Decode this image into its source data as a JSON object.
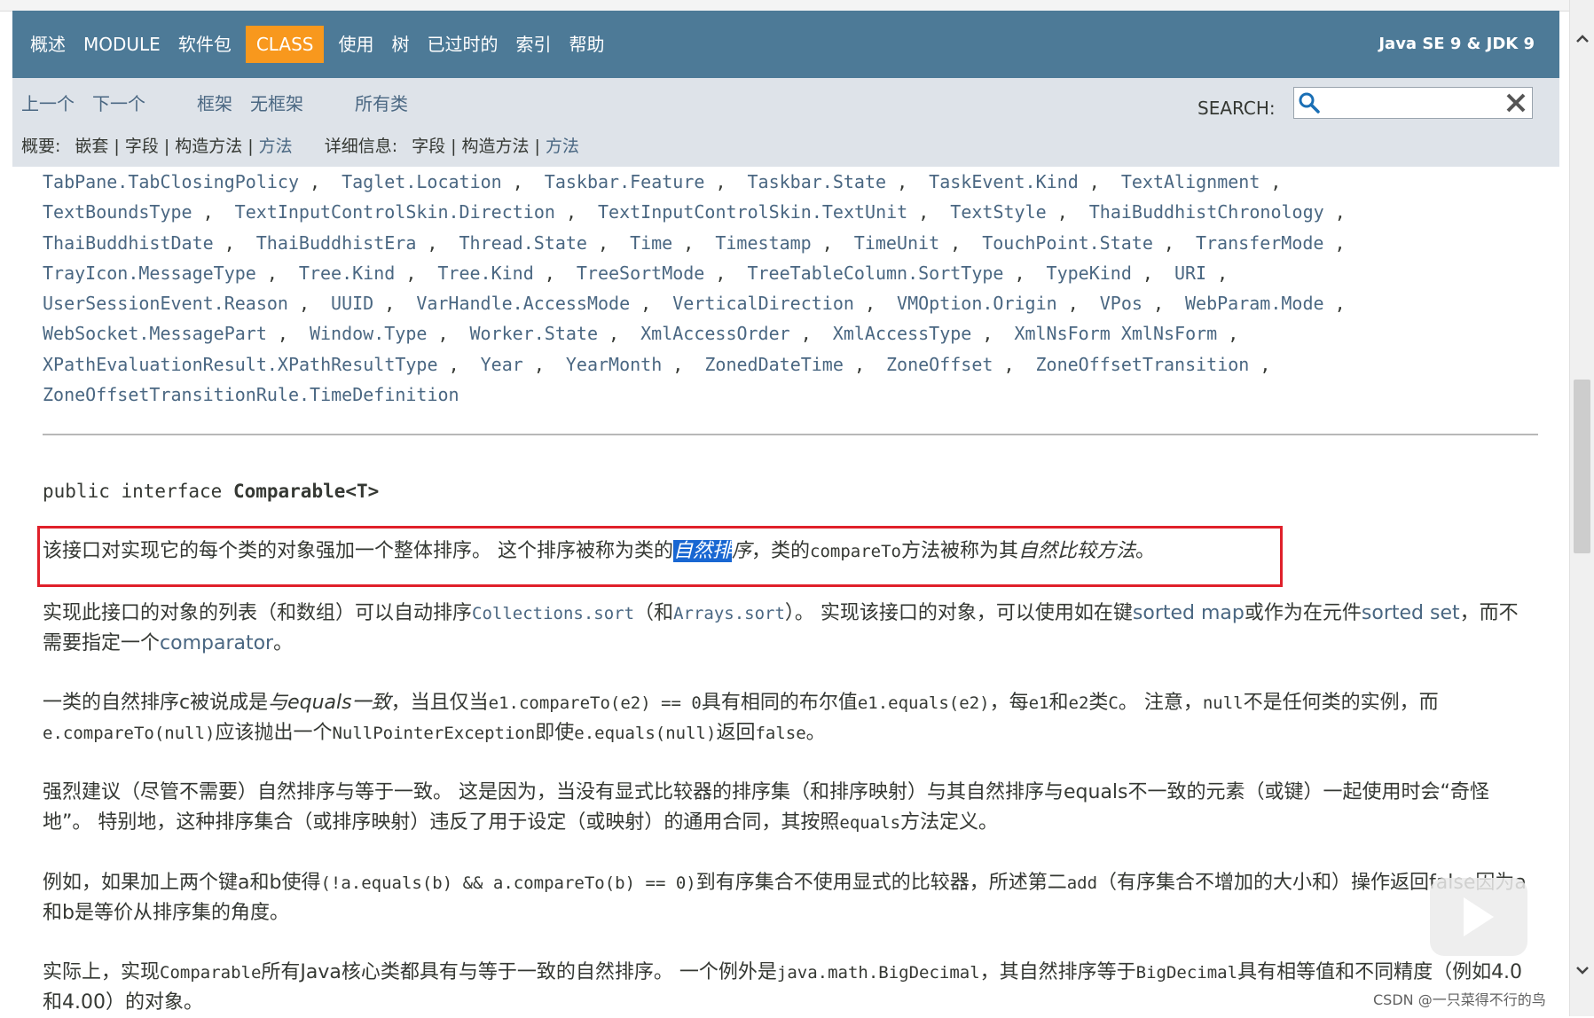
{
  "navbar": {
    "items": [
      "概述",
      "MODULE",
      "软件包",
      "CLASS",
      "使用",
      "树",
      "已过时的",
      "索引",
      "帮助"
    ],
    "active_index": 3,
    "brand": "Java SE 9 & JDK 9"
  },
  "subnav": {
    "prev": "上一个",
    "next": "下一个",
    "frames": "框架",
    "no_frames": "无框架",
    "all_classes": "所有类",
    "summary_label": "概要:",
    "summary_links": [
      {
        "text": "嵌套",
        "link": false
      },
      {
        "text": "字段",
        "link": false
      },
      {
        "text": "构造方法",
        "link": false
      },
      {
        "text": "方法",
        "link": true
      }
    ],
    "detail_label": "详细信息:",
    "detail_links": [
      {
        "text": "字段",
        "link": false
      },
      {
        "text": "构造方法",
        "link": false
      },
      {
        "text": "方法",
        "link": true
      }
    ],
    "search_label": "SEARCH:",
    "search_value": ""
  },
  "enum_lines": [
    [
      "TabPane.TabClosingPolicy",
      "Taglet.Location",
      "Taskbar.Feature",
      "Taskbar.State",
      "TaskEvent.Kind",
      "TextAlignment"
    ],
    [
      "TextBoundsType",
      "TextInputControlSkin.Direction",
      "TextInputControlSkin.TextUnit",
      "TextStyle",
      "ThaiBuddhistChronology"
    ],
    [
      "ThaiBuddhistDate",
      "ThaiBuddhistEra",
      "Thread.State",
      "Time",
      "Timestamp",
      "TimeUnit",
      "TouchPoint.State",
      "TransferMode"
    ],
    [
      "TrayIcon.MessageType",
      "Tree.Kind",
      "Tree.Kind",
      "TreeSortMode",
      "TreeTableColumn.SortType",
      "TypeKind",
      "URI"
    ],
    [
      "UserSessionEvent.Reason",
      "UUID",
      "VarHandle.AccessMode",
      "VerticalDirection",
      "VMOption.Origin",
      "VPos",
      "WebParam.Mode"
    ],
    [
      "WebSocket.MessagePart",
      "Window.Type",
      "Worker.State",
      "XmlAccessOrder",
      "XmlAccessType",
      "XmlNsForm XmlNsForm"
    ],
    [
      "XPathEvaluationResult.XPathResultType",
      "Year",
      "YearMonth",
      "ZonedDateTime",
      "ZoneOffset",
      "ZoneOffsetTransition"
    ],
    [
      "ZoneOffsetTransitionRule.TimeDefinition"
    ]
  ],
  "signature": {
    "prefix": "public interface ",
    "name": "Comparable<T>"
  },
  "para1": {
    "t1": "该接口对实现它的每个类的对象强加一个整体排序。 这个排序被称为类的",
    "hl": "自然排",
    "t2": "序",
    "t3": "，类的",
    "code": "compareTo",
    "t4": "方法被称为其",
    "t5": "自然比较方法",
    "t6": "。"
  },
  "para2": {
    "t1": "实现此接口的对象的列表（和数组）可以自动排序",
    "c1": "Collections.sort",
    "t2": "（和",
    "c2": "Arrays.sort",
    "t3": "）。 实现该接口的对象，可以使用如在键",
    "l1": "sorted map",
    "t4": "或作为在元件",
    "l2": "sorted set",
    "t5": "，而不需要指定一个",
    "l3": "comparator",
    "t6": "。"
  },
  "para3": {
    "t1": "一类的自然排序c被说成是",
    "i1": "与equals一致",
    "t2": "，当且仅当",
    "c1": "e1.compareTo(e2) == 0",
    "t3": "具有相同的布尔值",
    "c2": "e1.equals(e2)",
    "t4": "，每",
    "c3": "e1",
    "t5": "和",
    "c4": "e2",
    "t6": "类",
    "c5": "C",
    "t7": "。 注意，",
    "c6": "null",
    "t8": "不是任何类的实例，而",
    "c7": "e.compareTo(null)",
    "t9": "应该抛出一个",
    "c8": "NullPointerException",
    "t10": "即使",
    "c9": "e.equals(null)",
    "t11": "返回",
    "c10": "false",
    "t12": "。"
  },
  "para4": {
    "t1": "强烈建议（尽管不需要）自然排序与等于一致。 这是因为，当没有显式比较器的排序集（和排序映射）与其自然排序与equals不一致的元素（或键）一起使用时会“奇怪地”。 特别地，这种排序集合（或排序映射）违反了用于设定（或映射）的通用合同，其按照",
    "c1": "equals",
    "t2": "方法定义。"
  },
  "para5": {
    "t1": "例如，如果加上两个键a和b使得",
    "c1": "(!a.equals(b) && a.compareTo(b) == 0)",
    "t2": "到有序集合不使用显式的比较器，所述第二",
    "c2": "add",
    "t3": "（有序集合不增加的大小和）操作返回false因为a和b是等价从排序集的角度。"
  },
  "para6": {
    "t1": "实际上，实现",
    "c1": "Comparable",
    "t2": "所有Java核心类都具有与等于一致的自然排序。 一个例外是",
    "c2": "java.math.BigDecimal",
    "t3": "，其自然排序等于",
    "c3": "BigDecimal",
    "t4": "具有相等值和不同精度（例如4.0和4.00）的对象。"
  },
  "watermark": "CSDN @一只菜得不行的鸟",
  "colors": {
    "nav_bg": "#4d7a97",
    "active_tab": "#f8981d",
    "subnav_bg": "#dee3e9",
    "link": "#4a6782",
    "highlight": "#1967d2",
    "annotation_box": "#e0202a"
  }
}
